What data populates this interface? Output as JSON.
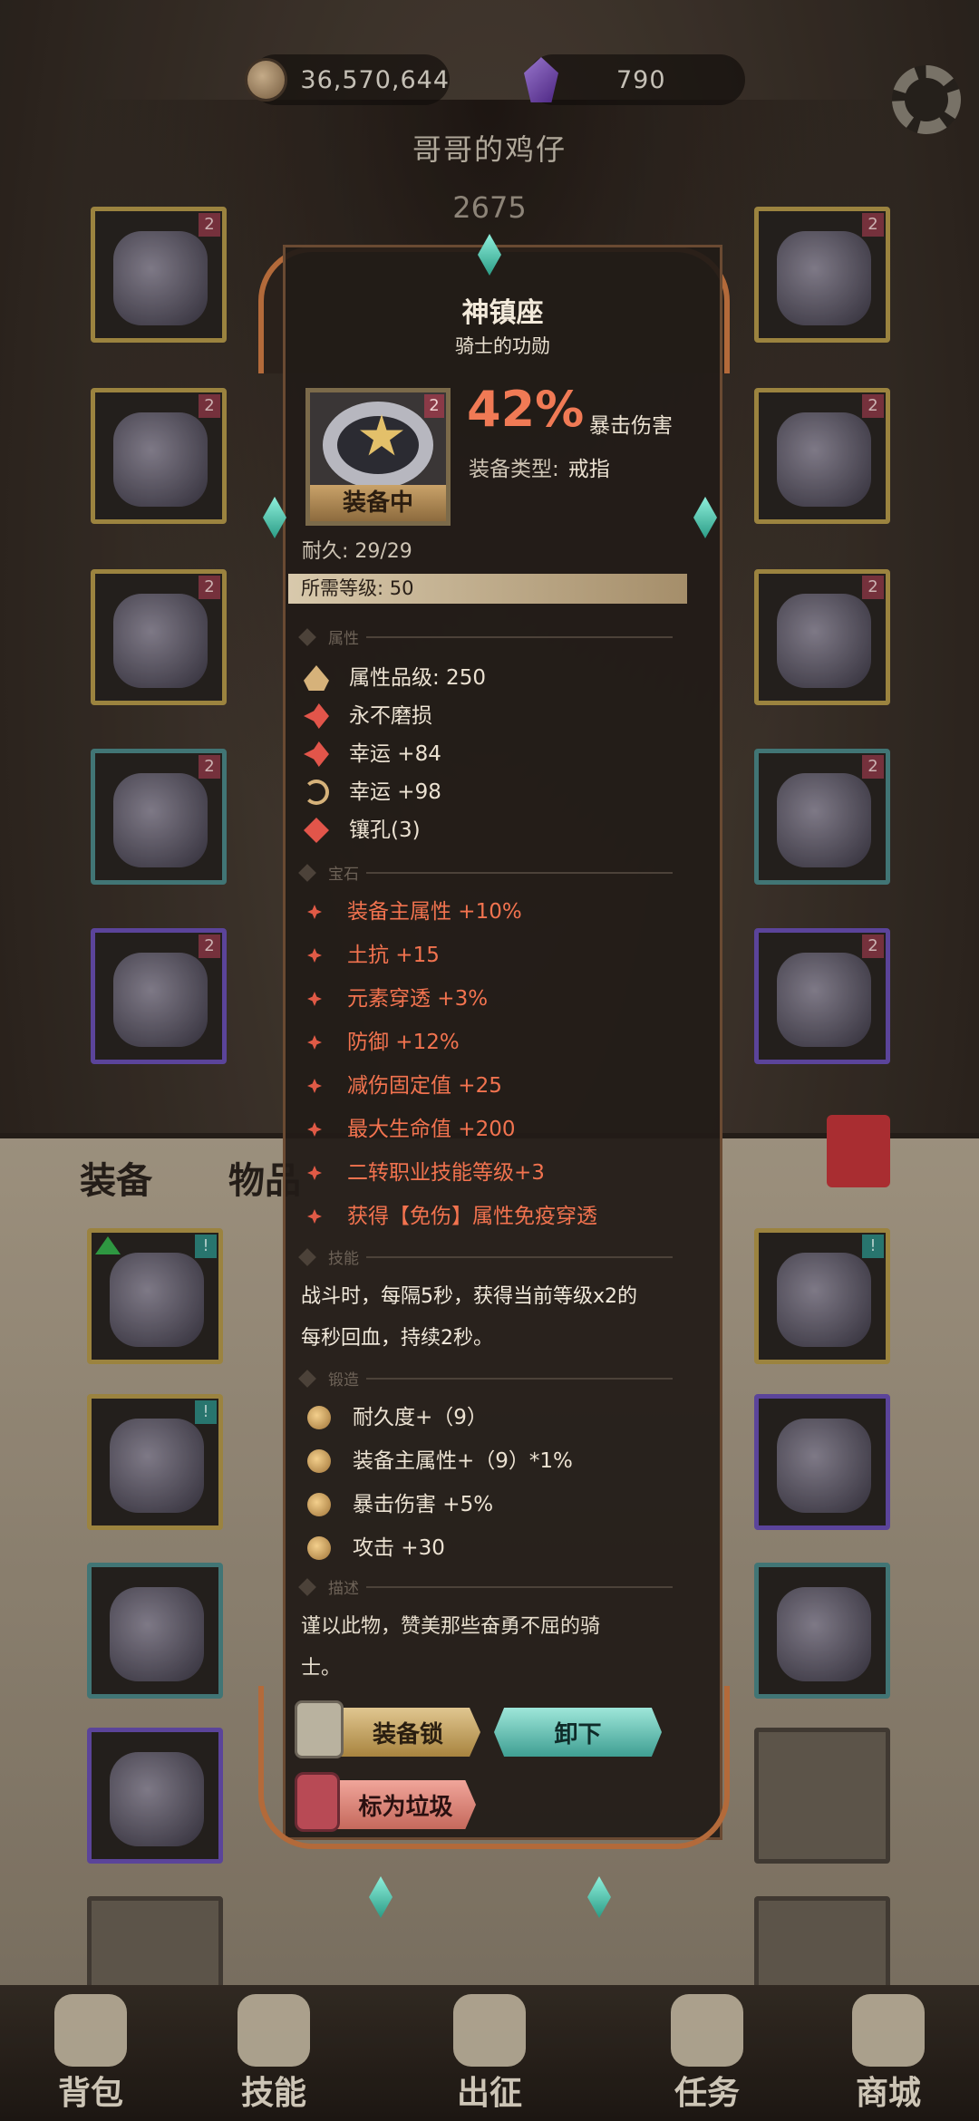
{
  "topbar": {
    "coins": "36,570,644",
    "gems": "790",
    "player_name": "哥哥的鸡仔",
    "power": "2675"
  },
  "tabs": {
    "equipment": "装备",
    "items": "物品"
  },
  "popup": {
    "title": "神镇座",
    "subtitle": "骑士的功勋",
    "icon_badge": "2",
    "equipped_label": "装备中",
    "crit_value": "42%",
    "crit_label": "暴击伤害",
    "equip_type_label": "装备类型:",
    "equip_type_value": "戒指",
    "durability": "耐久: 29/29",
    "required_level": "所需等级: 50",
    "sections": {
      "attributes": "属性",
      "gems": "宝石",
      "skills": "技能",
      "forge": "锻造",
      "description": "描述"
    },
    "attributes": [
      {
        "icon": "quality-icon",
        "text": "属性品级: 250"
      },
      {
        "icon": "unbreakable-icon",
        "text": "永不磨损"
      },
      {
        "icon": "luck-icon",
        "text": "幸运 +84"
      },
      {
        "icon": "cycle-icon",
        "text": "幸运 +98"
      },
      {
        "icon": "socket-icon",
        "text": "镶孔(3)"
      }
    ],
    "gems": [
      "装备主属性 +10%",
      "土抗 +15",
      "元素穿透 +3%",
      "防御 +12%",
      "减伤固定值 +25",
      "最大生命值 +200",
      "二转职业技能等级+3",
      "获得【免伤】属性免疫穿透"
    ],
    "skill_line1": "战斗时，每隔5秒，获得当前等级x2的",
    "skill_line2": "每秒回血，持续2秒。",
    "forge": [
      "耐久度+（9）",
      "装备主属性+（9）*1%",
      "暴击伤害 +5%",
      "攻击 +30"
    ],
    "desc_line1": "谨以此物，赞美那些奋勇不屈的骑",
    "desc_line2": "士。",
    "buttons": {
      "lock": "装备锁",
      "unequip": "卸下",
      "mark_junk": "标为垃圾"
    }
  },
  "slot_badges": {
    "red": "2",
    "teal": "!"
  },
  "bottom_nav": [
    {
      "label": "背包",
      "icon": "backpack-icon"
    },
    {
      "label": "技能",
      "icon": "skill-book-icon"
    },
    {
      "label": "出征",
      "icon": "battle-icon"
    },
    {
      "label": "任务",
      "icon": "quest-icon"
    },
    {
      "label": "商城",
      "icon": "shop-icon"
    }
  ],
  "colors": {
    "accent_orange": "#f07a55",
    "gem_red": "#f2734f",
    "teal_button": "#3f9f93",
    "gold_button": "#a8843f"
  }
}
